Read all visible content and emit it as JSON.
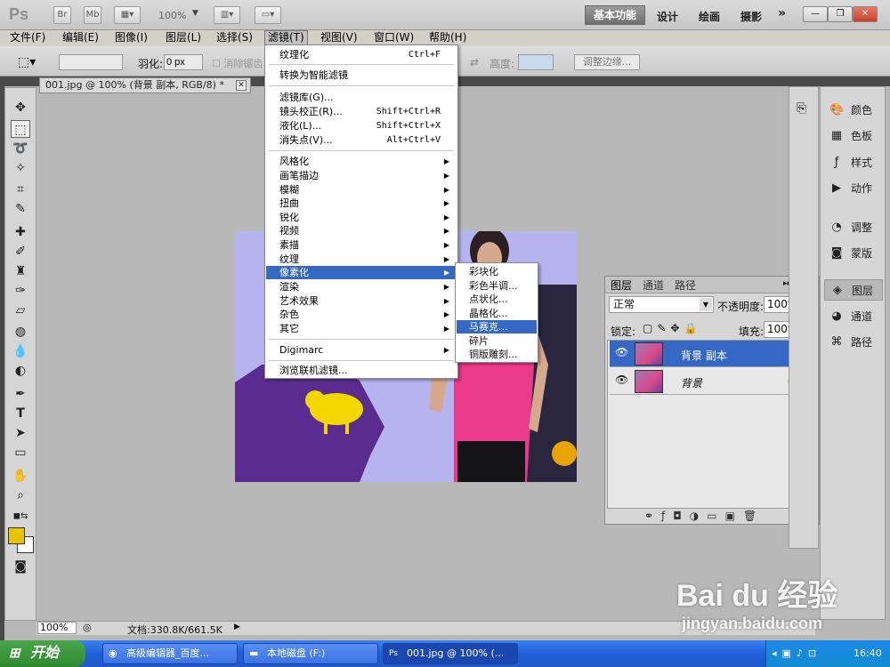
{
  "app": {
    "logo": "Ps",
    "bridge_btn": "Br",
    "minibridge_btn": "Mb",
    "zoom": "100%",
    "workspaces": [
      "基本功能",
      "设计",
      "绘画",
      "摄影"
    ],
    "more": "»"
  },
  "menubar": [
    "文件(F)",
    "编辑(E)",
    "图像(I)",
    "图层(L)",
    "选择(S)",
    "滤镜(T)",
    "视图(V)",
    "窗口(W)",
    "帮助(H)"
  ],
  "options": {
    "feather_label": "羽化:",
    "feather_value": "0 px",
    "antialias_label": "消除锯齿",
    "height_label": "高度:",
    "refine_edge": "调整边缘..."
  },
  "document": {
    "tab_title": "001.jpg @ 100% (背景 副本, RGB/8) *",
    "status_zoom": "100%",
    "status_doc": "文档:330.8K/661.5K"
  },
  "filter_menu": {
    "top": [
      {
        "label": "纹理化",
        "shortcut": "Ctrl+F"
      },
      {
        "label": "转换为智能滤镜",
        "shortcut": ""
      }
    ],
    "group2": [
      {
        "label": "滤镜库(G)...",
        "shortcut": ""
      },
      {
        "label": "镜头校正(R)...",
        "shortcut": "Shift+Ctrl+R"
      },
      {
        "label": "液化(L)...",
        "shortcut": "Shift+Ctrl+X"
      },
      {
        "label": "消失点(V)...",
        "shortcut": "Alt+Ctrl+V"
      }
    ],
    "submenus": [
      "风格化",
      "画笔描边",
      "模糊",
      "扭曲",
      "锐化",
      "视频",
      "素描",
      "纹理",
      "像素化",
      "渲染",
      "艺术效果",
      "杂色",
      "其它"
    ],
    "digimarc": "Digimarc",
    "browse": "浏览联机滤镜..."
  },
  "pixelate_submenu": [
    "彩块化",
    "彩色半调...",
    "点状化...",
    "晶格化...",
    "马赛克...",
    "碎片",
    "铜版雕刻..."
  ],
  "layers_panel": {
    "tabs": [
      "图层",
      "通道",
      "路径"
    ],
    "blend_mode": "正常",
    "opacity_label": "不透明度:",
    "opacity_value": "100%",
    "lock_label": "锁定:",
    "fill_label": "填充:",
    "fill_value": "100%",
    "layers": [
      {
        "name": "背景 副本",
        "selected": true
      },
      {
        "name": "背景",
        "selected": false
      }
    ]
  },
  "right_panels": [
    {
      "label": "颜色",
      "icon": "color-icon"
    },
    {
      "label": "色板",
      "icon": "swatches-icon"
    },
    {
      "label": "样式",
      "icon": "styles-icon"
    },
    {
      "label": "动作",
      "icon": "actions-icon"
    },
    {
      "label": "调整",
      "icon": "adjustments-icon"
    },
    {
      "label": "蒙版",
      "icon": "masks-icon"
    },
    {
      "label": "图层",
      "icon": "layers-icon"
    },
    {
      "label": "通道",
      "icon": "channels-icon"
    },
    {
      "label": "路径",
      "icon": "paths-icon"
    }
  ],
  "taskbar": {
    "start": "开始",
    "tasks": [
      "高级编辑器_百度...",
      "本地磁盘 (F:)",
      "001.jpg @ 100% (..."
    ],
    "clock": "16:40"
  },
  "watermark": {
    "brand": "Bai du 经验",
    "url": "jingyan.baidu.com"
  },
  "colors": {
    "highlight": "#3468c4",
    "foreground_swatch": "#e8c400",
    "background_swatch": "#ffffff"
  }
}
